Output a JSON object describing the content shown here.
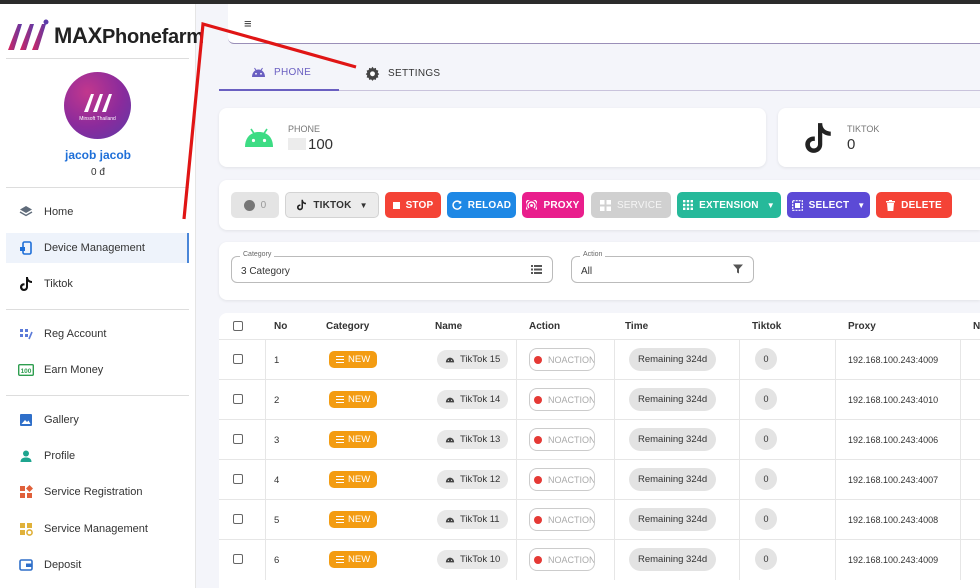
{
  "app": {
    "brand": "MAXPhonefarm",
    "brand_bold": "MAX",
    "brand_rest": "Phonefarm"
  },
  "user": {
    "name": "jacob jacob",
    "balance": "0 đ",
    "avatar_caption": "Minsoft Thailand"
  },
  "nav": [
    {
      "label": "Home",
      "icon": "home-icon"
    },
    {
      "label": "Device Management",
      "icon": "device-icon",
      "active": true
    },
    {
      "label": "Tiktok",
      "icon": "tiktok-icon"
    },
    {
      "label": "Reg Account",
      "icon": "reg-account-icon"
    },
    {
      "label": "Earn Money",
      "icon": "earn-money-icon"
    },
    {
      "label": "Gallery",
      "icon": "gallery-icon"
    },
    {
      "label": "Profile",
      "icon": "profile-icon"
    },
    {
      "label": "Service Registration",
      "icon": "service-registration-icon"
    },
    {
      "label": "Service Management",
      "icon": "service-management-icon"
    },
    {
      "label": "Deposit",
      "icon": "deposit-icon"
    }
  ],
  "header": {
    "menu_icon": "≡"
  },
  "tabs": [
    {
      "label": "PHONE",
      "icon": "android-icon",
      "active": true
    },
    {
      "label": "SETTINGS",
      "icon": "gear-icon"
    }
  ],
  "stats": {
    "phone": {
      "label": "PHONE",
      "value": "100"
    },
    "tiktok": {
      "label": "TIKTOK",
      "value": "0"
    }
  },
  "toolbar": {
    "toggle_count": "0",
    "tiktok": "TIKTOK",
    "stop": "STOP",
    "reload": "RELOAD",
    "proxy": "PROXY",
    "service": "SERVICE",
    "extension": "EXTENSION",
    "select": "SELECT",
    "delete": "DELETE"
  },
  "colors": {
    "stop": "#f44336",
    "reload": "#1e88e5",
    "proxy": "#e91e8c",
    "service": "#cfcfcf",
    "extension": "#26b99a",
    "select": "#5c4ad6",
    "delete": "#f44336",
    "new_badge": "#f39c12",
    "accent": "#6a5fc1"
  },
  "filters": {
    "category": {
      "legend": "Category",
      "value": "3 Category"
    },
    "action": {
      "legend": "Action",
      "value": "All"
    }
  },
  "table": {
    "headers": [
      "No",
      "Category",
      "Name",
      "Action",
      "Time",
      "Tiktok",
      "Proxy",
      "N"
    ],
    "rows": [
      {
        "no": "1",
        "category": "NEW",
        "name": "TikTok 15",
        "action": "NOACTION",
        "time": "Remaining 324d",
        "tiktok": "0",
        "proxy": "192.168.100.243:4009"
      },
      {
        "no": "2",
        "category": "NEW",
        "name": "TikTok 14",
        "action": "NOACTION",
        "time": "Remaining 324d",
        "tiktok": "0",
        "proxy": "192.168.100.243:4010"
      },
      {
        "no": "3",
        "category": "NEW",
        "name": "TikTok 13",
        "action": "NOACTION",
        "time": "Remaining 324d",
        "tiktok": "0",
        "proxy": "192.168.100.243:4006"
      },
      {
        "no": "4",
        "category": "NEW",
        "name": "TikTok 12",
        "action": "NOACTION",
        "time": "Remaining 324d",
        "tiktok": "0",
        "proxy": "192.168.100.243:4007"
      },
      {
        "no": "5",
        "category": "NEW",
        "name": "TikTok 11",
        "action": "NOACTION",
        "time": "Remaining 324d",
        "tiktok": "0",
        "proxy": "192.168.100.243:4008"
      },
      {
        "no": "6",
        "category": "NEW",
        "name": "TikTok 10",
        "action": "NOACTION",
        "time": "Remaining 324d",
        "tiktok": "0",
        "proxy": "192.168.100.243:4009"
      }
    ]
  }
}
